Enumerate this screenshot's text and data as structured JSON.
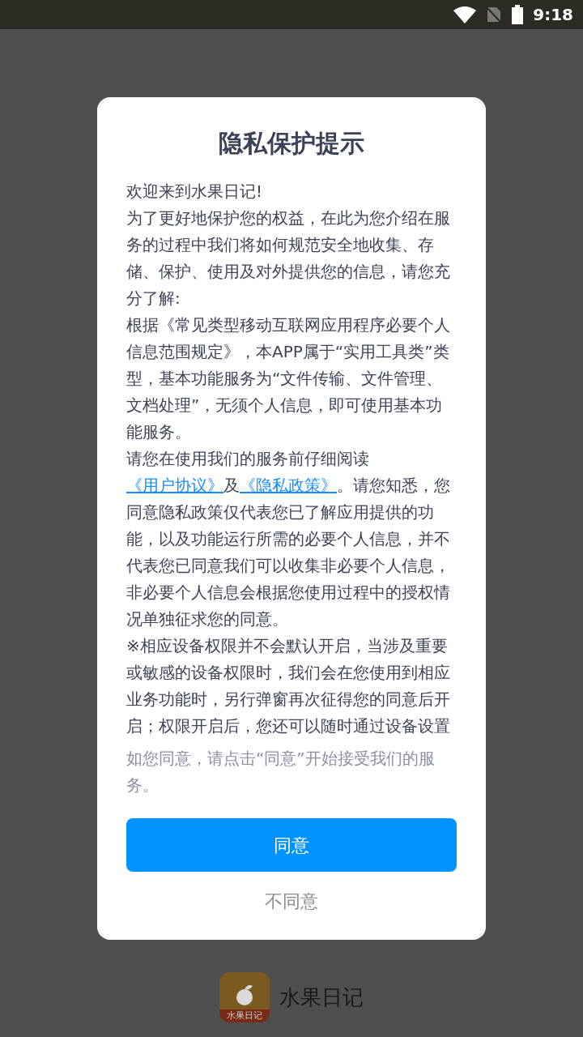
{
  "status_bar": {
    "time": "9:18"
  },
  "dialog": {
    "title": "隐私保护提示",
    "paragraphs": [
      {
        "kind": "text",
        "text": "欢迎来到水果日记!"
      },
      {
        "kind": "text",
        "text": "为了更好地保护您的权益，在此为您介绍在服务的过程中我们将如何规范安全地收集、存储、保护、使用及对外提供您的信息，请您充分了解:"
      },
      {
        "kind": "text",
        "text": "根据《常见类型移动互联网应用程序必要个人信息范围规定》，本APP属于“实用工具类”类型，基本功能服务为“文件传输、文件管理、文档处理”，无须个人信息，即可使用基本功能服务。"
      },
      {
        "kind": "links",
        "parts": [
          {
            "kind": "text",
            "text": "请您在使用我们的服务前仔细阅读"
          },
          {
            "kind": "link",
            "text": "《用户协议》"
          },
          {
            "kind": "text",
            "text": "及"
          },
          {
            "kind": "link",
            "text": "《隐私政策》"
          },
          {
            "kind": "text",
            "text": "。请您知悉，您同意隐私政策仅代表您已了解应用提供的功能，以及功能运行所需的必要个人信息，并不代表您已同意我们可以收集非必要个人信息，非必要个人信息会根据您使用过程中的授权情况单独征求您的同意。"
          }
        ]
      },
      {
        "kind": "text",
        "text": "※相应设备权限并不会默认开启，当涉及重要或敏感的设备权限时，我们会在您使用到相应业务功能时，另行弹窗再次征得您的同意后开启；权限开启后，您还可以随时通过设备设置"
      }
    ],
    "note": "如您同意，请点击“同意”开始接受我们的服务。",
    "agree_button": "同意",
    "disagree_button": "不同意"
  },
  "app": {
    "icon_label": "水果日记",
    "name": "水果日记"
  }
}
